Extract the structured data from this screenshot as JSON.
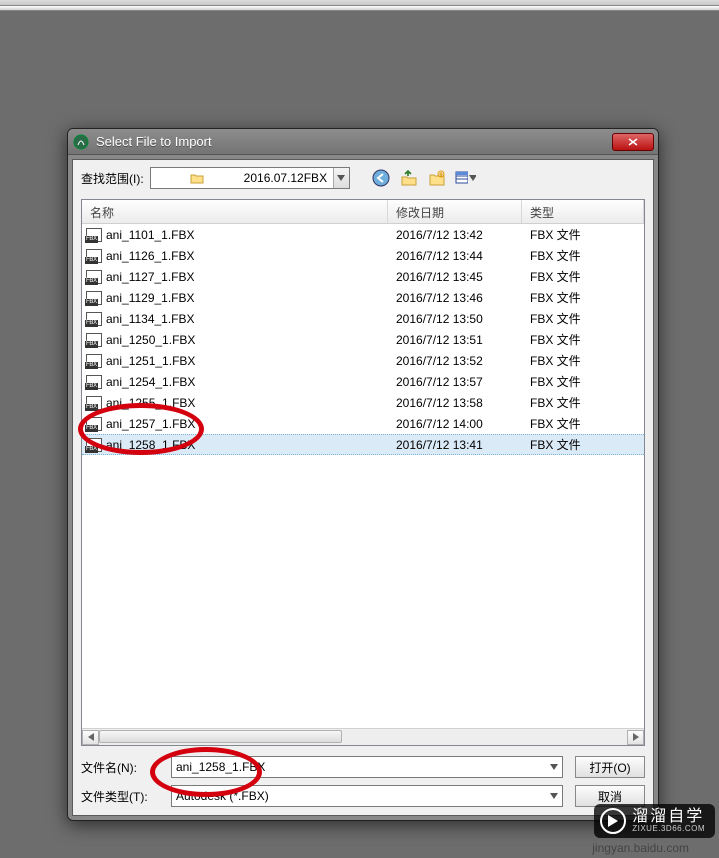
{
  "dialog": {
    "title": "Select File to Import",
    "look_in_label": "查找范围(I):",
    "folder_name": "2016.07.12FBX",
    "columns": {
      "name": "名称",
      "date": "修改日期",
      "type": "类型"
    },
    "files": [
      {
        "name": "ani_1101_1.FBX",
        "date": "2016/7/12 13:42",
        "type": "FBX 文件",
        "selected": false
      },
      {
        "name": "ani_1126_1.FBX",
        "date": "2016/7/12 13:44",
        "type": "FBX 文件",
        "selected": false
      },
      {
        "name": "ani_1127_1.FBX",
        "date": "2016/7/12 13:45",
        "type": "FBX 文件",
        "selected": false
      },
      {
        "name": "ani_1129_1.FBX",
        "date": "2016/7/12 13:46",
        "type": "FBX 文件",
        "selected": false
      },
      {
        "name": "ani_1134_1.FBX",
        "date": "2016/7/12 13:50",
        "type": "FBX 文件",
        "selected": false
      },
      {
        "name": "ani_1250_1.FBX",
        "date": "2016/7/12 13:51",
        "type": "FBX 文件",
        "selected": false
      },
      {
        "name": "ani_1251_1.FBX",
        "date": "2016/7/12 13:52",
        "type": "FBX 文件",
        "selected": false
      },
      {
        "name": "ani_1254_1.FBX",
        "date": "2016/7/12 13:57",
        "type": "FBX 文件",
        "selected": false
      },
      {
        "name": "ani_1255_1.FBX",
        "date": "2016/7/12 13:58",
        "type": "FBX 文件",
        "selected": false
      },
      {
        "name": "ani_1257_1.FBX",
        "date": "2016/7/12 14:00",
        "type": "FBX 文件",
        "selected": false
      },
      {
        "name": "ani_1258_1.FBX",
        "date": "2016/7/12 13:41",
        "type": "FBX 文件",
        "selected": true
      }
    ],
    "filename_label": "文件名(N):",
    "filetype_label": "文件类型(T):",
    "filename_value": "ani_1258_1.FBX",
    "filetype_value": "Autodesk (*.FBX)",
    "open_button": "打开(O)",
    "cancel_button": "取消"
  },
  "watermark": {
    "main": "溜溜自学",
    "sub": "ZIXUE.3D66.COM",
    "bottom": "jingyan.baidu.com"
  }
}
